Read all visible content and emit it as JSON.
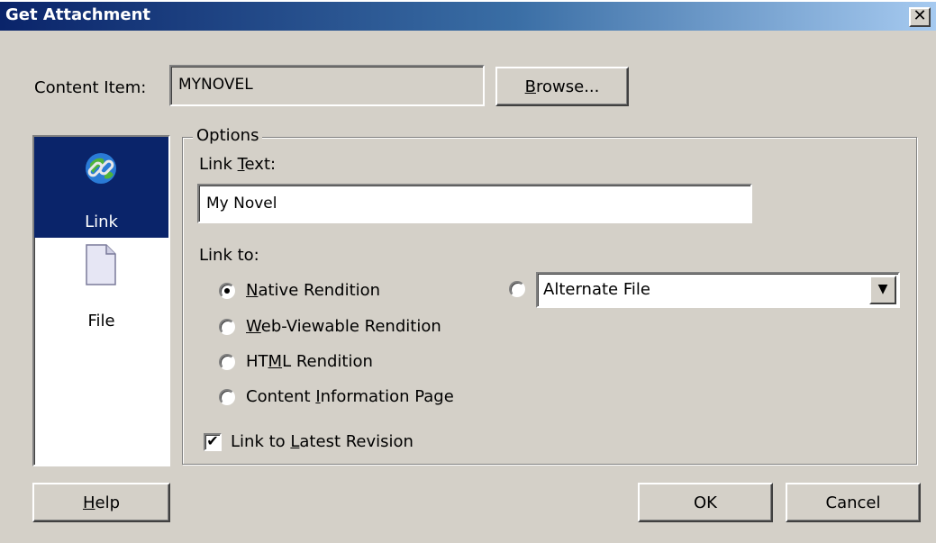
{
  "window": {
    "title": "Get Attachment",
    "close_glyph": "✕"
  },
  "content_item": {
    "label": "Content Item:",
    "value": "MYNOVEL",
    "browse_label": "Browse..."
  },
  "left_pane": {
    "items": [
      {
        "label": "Link",
        "icon": "globe-link-icon",
        "selected": true
      },
      {
        "label": "File",
        "icon": "file-icon",
        "selected": false
      }
    ]
  },
  "options": {
    "legend": "Options",
    "link_text_label": "Link Text:",
    "link_text_value": "My Novel",
    "link_to_label": "Link to:",
    "radios": [
      {
        "label": "Native Rendition",
        "checked": true
      },
      {
        "label": "Web-Viewable Rendition",
        "checked": false
      },
      {
        "label": "HTML Rendition",
        "checked": false
      },
      {
        "label": "Content Information Page",
        "checked": false
      }
    ],
    "alternate": {
      "checked": false,
      "select_value": "Alternate File"
    },
    "latest_revision": {
      "label": "Link to Latest Revision",
      "checked": true
    }
  },
  "footer": {
    "help_label": "Help",
    "ok_label": "OK",
    "cancel_label": "Cancel"
  },
  "colors": {
    "titlebar_start": "#0a246a",
    "titlebar_end": "#a6caf0",
    "dialog_bg": "#d4d0c8",
    "selection": "#0a246a"
  }
}
